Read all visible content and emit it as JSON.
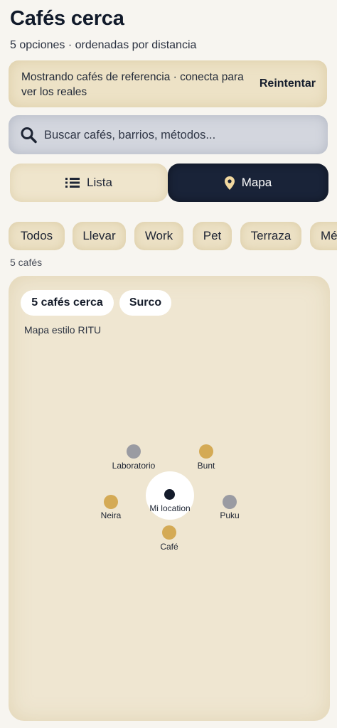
{
  "header": {
    "title": "Cafés cerca",
    "subtitle": "5 opciones · ordenadas por distancia"
  },
  "banner": {
    "message": "Mostrando cafés de referencia · conecta para ver los reales",
    "action_label": "Reintentar"
  },
  "search": {
    "placeholder": "Buscar cafés, barrios, métodos...",
    "value": "",
    "icon": "search-icon"
  },
  "view_toggle": {
    "list_label": "Lista",
    "list_icon": "list-icon",
    "map_label": "Mapa",
    "map_icon": "location-pin-icon",
    "selected": "Mapa"
  },
  "filters": [
    "Todos",
    "Llevar",
    "Work",
    "Pet",
    "Terraza",
    "Mé"
  ],
  "results_count": "5 cafés",
  "map": {
    "count_pill": "5 cafés cerca",
    "area_pill": "Surco",
    "style_note": "Mapa estilo RITU",
    "user_label": "Mi location",
    "pins": [
      {
        "label": "Laboratorio",
        "color": "#9a9ba2"
      },
      {
        "label": "Bunt",
        "color": "#d4aa55"
      },
      {
        "label": "Neira",
        "color": "#d4aa55"
      },
      {
        "label": "Puku",
        "color": "#9a9ba2"
      },
      {
        "label": "Café",
        "color": "#d4aa55"
      }
    ]
  },
  "colors": {
    "accent_dark": "#192338",
    "sand": "#ede2c6",
    "search_bg": "#d3d6de",
    "pin_gold": "#d4aa55",
    "pin_grey": "#9a9ba2"
  }
}
